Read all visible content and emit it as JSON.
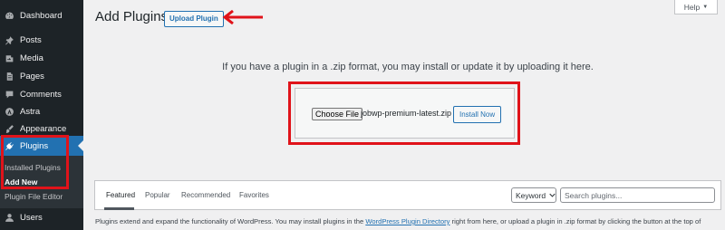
{
  "sidebar": {
    "items": [
      {
        "label": "Dashboard",
        "icon": "dashboard-icon"
      },
      {
        "label": "Posts",
        "icon": "pin-icon"
      },
      {
        "label": "Media",
        "icon": "media-icon"
      },
      {
        "label": "Pages",
        "icon": "pages-icon"
      },
      {
        "label": "Comments",
        "icon": "comment-icon"
      },
      {
        "label": "Astra",
        "icon": "astra-icon"
      },
      {
        "label": "Appearance",
        "icon": "brush-icon"
      },
      {
        "label": "Plugins",
        "icon": "plug-icon",
        "active": true
      },
      {
        "label": "Users",
        "icon": "user-icon"
      }
    ],
    "submenu": [
      {
        "label": "Installed Plugins"
      },
      {
        "label": "Add New",
        "current": true
      },
      {
        "label": "Plugin File Editor"
      }
    ]
  },
  "header": {
    "title": "Add Plugins",
    "upload_button": "Upload Plugin",
    "help_label": "Help"
  },
  "upload": {
    "instructions": "If you have a plugin in a .zip format, you may install or update it by uploading it here.",
    "choose_file_label": "Choose File",
    "file_name": "jobwp-premium-latest.zip",
    "install_label": "Install Now"
  },
  "filter": {
    "tabs": [
      {
        "label": "Featured",
        "current": true
      },
      {
        "label": "Popular"
      },
      {
        "label": "Recommended"
      },
      {
        "label": "Favorites"
      }
    ],
    "search_type": "Keyword",
    "search_placeholder": "Search plugins..."
  },
  "description": {
    "before": "Plugins extend and expand the functionality of WordPress. You may install plugins in the ",
    "link": "WordPress Plugin Directory",
    "after": " right from here, or upload a plugin in .zip format by clicking the button at the top of"
  },
  "colors": {
    "accent": "#2271b1",
    "annotation_red": "#e0131a",
    "sidebar_bg": "#1d2327"
  }
}
